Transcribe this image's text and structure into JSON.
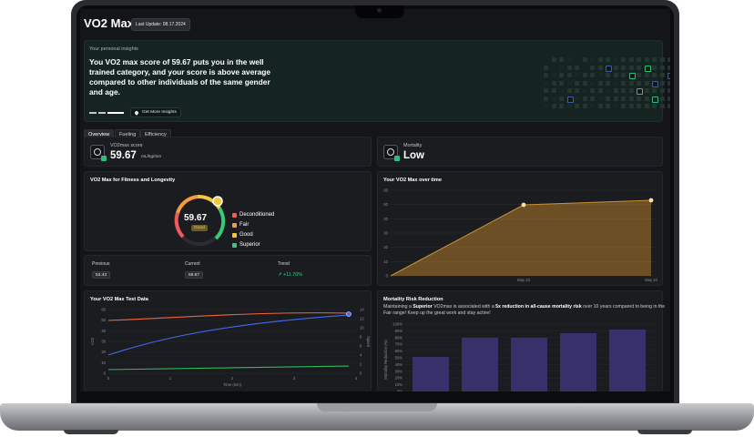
{
  "header": {
    "title": "VO2 Max",
    "last_update": "Last Update: 08.17.2024"
  },
  "insights": {
    "label": "Your personal insights",
    "text": "You VO2 max score of 59.67 puts you in the well trained category, and your score is above average compared to other individuals of the same gender and age.",
    "button_label": "Get More Insights"
  },
  "tabs": [
    {
      "label": "Overview"
    },
    {
      "label": "Fueling"
    },
    {
      "label": "Efficiency"
    }
  ],
  "score_card": {
    "label": "VO2max score",
    "value": "59.67",
    "unit": "mL/kg/min"
  },
  "mortality_card": {
    "label": "Mortality",
    "value": "Low"
  },
  "fitness": {
    "title": "VO2 Max for Fitness and Longevity",
    "gauge_value": "59.67",
    "gauge_badge": "Good",
    "legend": [
      {
        "label": "Deconditioned",
        "color": "#f05a5a"
      },
      {
        "label": "Fair",
        "color": "#f59b3d"
      },
      {
        "label": "Good",
        "color": "#f3c63f"
      },
      {
        "label": "Superior",
        "color": "#35c979"
      }
    ],
    "stats": {
      "previous_label": "Previous",
      "previous_value": "53.43",
      "current_label": "Current",
      "current_value": "59.67",
      "trend_label": "Trend",
      "trend_value": "+11.70%"
    }
  },
  "over_time": {
    "title": "Your VO2 Max over time",
    "chart_data": {
      "type": "area",
      "y_ticks": [
        "60",
        "50",
        "40",
        "30",
        "20",
        "10",
        "0"
      ],
      "x_labels": [
        "May 23",
        "May 24"
      ],
      "ylim": [
        0,
        60
      ],
      "color": "#b07a2a"
    }
  },
  "test_data": {
    "title": "Your VO2 Max Test Data",
    "chart_data": {
      "type": "line",
      "xlabel": "Time (min)",
      "ylabel": "VO2",
      "y2label": "Speed",
      "x_ticks": [
        "0",
        "1",
        "2",
        "3",
        "4"
      ],
      "y_ticks": [
        "60",
        "50",
        "40",
        "30",
        "20",
        "10",
        "0"
      ],
      "y2_ticks": [
        "14",
        "12",
        "10",
        "8",
        "6",
        "4",
        "2",
        "0"
      ],
      "series": [
        {
          "color": "#f0643c"
        },
        {
          "color": "#3f6bf0"
        },
        {
          "color": "#2ebd5a"
        }
      ]
    }
  },
  "mortality_reduction": {
    "title": "Mortality Risk Reduction",
    "text_pre": "Maintaining a ",
    "text_b1": "Superior",
    "text_mid": " VO2max is associated with a ",
    "text_b2": "5x reduction in all-cause mortality risk",
    "text_post": " over 10 years compared to being in the Fair range! Keep up the great work and stay active!",
    "chart_data": {
      "type": "bar",
      "ylabel": "Mortality Reduction (%)",
      "y_ticks": [
        "100%",
        "90%",
        "80%",
        "70%",
        "60%",
        "50%",
        "40%",
        "30%",
        "20%",
        "10%",
        "0%"
      ],
      "color": "#36306b"
    }
  }
}
